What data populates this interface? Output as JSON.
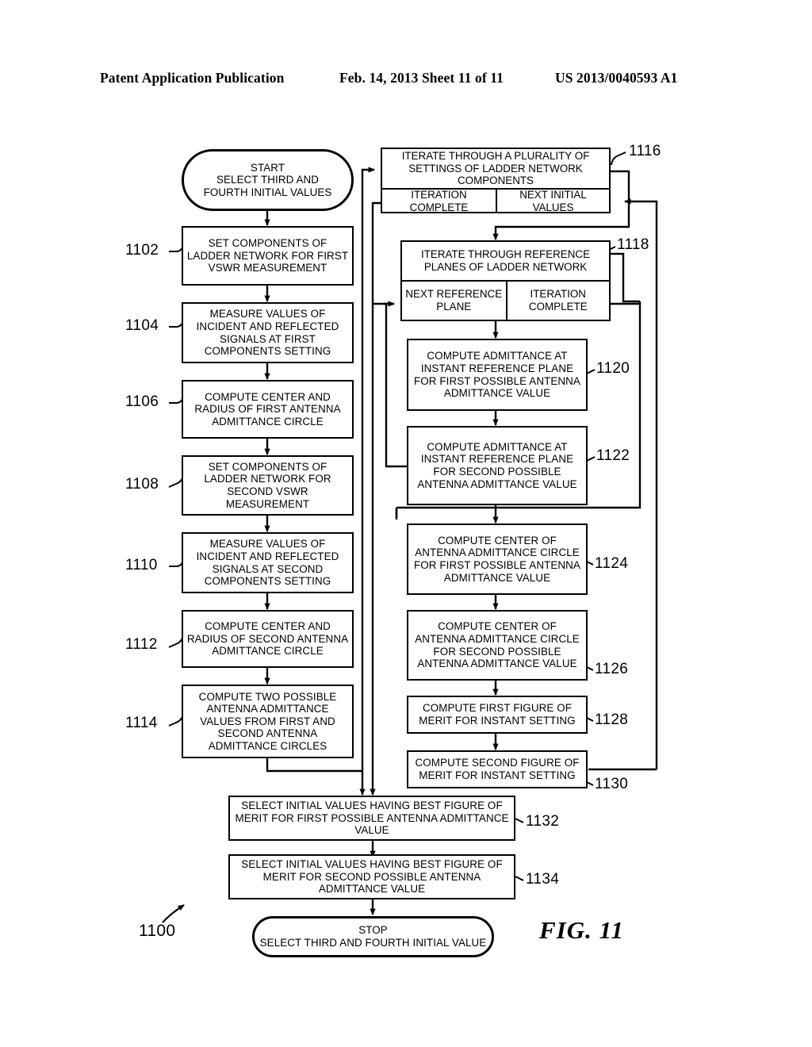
{
  "header": {
    "left": "Patent Application Publication",
    "middle": "Feb. 14, 2013  Sheet 11 of 11",
    "right": "US 2013/0040593 A1"
  },
  "figure": {
    "label": "FIG. 11",
    "flow_numeral": "1100"
  },
  "nodes": {
    "start": {
      "numeral": "",
      "line1": "START",
      "line2": "SELECT THIRD AND",
      "line3": "FOURTH INITIAL VALUES"
    },
    "n1102": {
      "numeral": "1102",
      "text": "SET COMPONENTS OF LADDER NETWORK FOR FIRST VSWR MEASUREMENT"
    },
    "n1104": {
      "numeral": "1104",
      "text": "MEASURE VALUES OF INCIDENT AND REFLECTED SIGNALS AT FIRST COMPONENTS SETTING"
    },
    "n1106": {
      "numeral": "1106",
      "text": "COMPUTE CENTER AND RADIUS OF FIRST ANTENNA ADMITTANCE CIRCLE"
    },
    "n1108": {
      "numeral": "1108",
      "text": "SET COMPONENTS OF LADDER NETWORK FOR SECOND VSWR MEASUREMENT"
    },
    "n1110": {
      "numeral": "1110",
      "text": "MEASURE VALUES OF INCIDENT AND REFLECTED SIGNALS AT SECOND COMPONENTS SETTING"
    },
    "n1112": {
      "numeral": "1112",
      "text": "COMPUTE CENTER AND RADIUS OF SECOND ANTENNA ADMITTANCE CIRCLE"
    },
    "n1114": {
      "numeral": "1114",
      "text": "COMPUTE TWO POSSIBLE ANTENNA ADMITTANCE VALUES FROM FIRST AND SECOND ANTENNA ADMITTANCE CIRCLES"
    },
    "n1116": {
      "numeral": "1116",
      "title": "ITERATE THROUGH A PLURALITY OF SETTINGS OF LADDER NETWORK COMPONENTS",
      "left_cell": "ITERATION COMPLETE",
      "right_cell": "NEXT INITIAL VALUES"
    },
    "n1118": {
      "numeral": "1118",
      "title": "ITERATE THROUGH REFERENCE PLANES OF LADDER NETWORK",
      "left_cell": "NEXT REFERENCE PLANE",
      "right_cell": "ITERATION COMPLETE"
    },
    "n1120": {
      "numeral": "1120",
      "text": "COMPUTE ADMITTANCE AT INSTANT REFERENCE PLANE FOR FIRST POSSIBLE ANTENNA ADMITTANCE VALUE"
    },
    "n1122": {
      "numeral": "1122",
      "text": "COMPUTE ADMITTANCE AT INSTANT REFERENCE PLANE FOR SECOND POSSIBLE ANTENNA ADMITTANCE VALUE"
    },
    "n1124": {
      "numeral": "1124",
      "text": "COMPUTE CENTER OF ANTENNA ADMITTANCE CIRCLE FOR FIRST POSSIBLE ANTENNA ADMITTANCE VALUE"
    },
    "n1126": {
      "numeral": "1126",
      "text": "COMPUTE CENTER OF ANTENNA ADMITTANCE CIRCLE FOR SECOND POSSIBLE ANTENNA ADMITTANCE VALUE"
    },
    "n1128": {
      "numeral": "1128",
      "text": "COMPUTE FIRST FIGURE OF MERIT FOR INSTANT SETTING"
    },
    "n1130": {
      "numeral": "1130",
      "text": "COMPUTE SECOND FIGURE OF MERIT FOR INSTANT SETTING"
    },
    "n1132": {
      "numeral": "1132",
      "text": "SELECT INITIAL VALUES HAVING BEST FIGURE OF MERIT FOR FIRST POSSIBLE ANTENNA ADMITTANCE VALUE"
    },
    "n1134": {
      "numeral": "1134",
      "text": "SELECT INITIAL VALUES HAVING BEST FIGURE OF MERIT FOR SECOND POSSIBLE ANTENNA ADMITTANCE VALUE"
    },
    "stop": {
      "numeral": "",
      "line1": "STOP",
      "line2": "SELECT THIRD AND FOURTH INITIAL VALUE"
    }
  }
}
